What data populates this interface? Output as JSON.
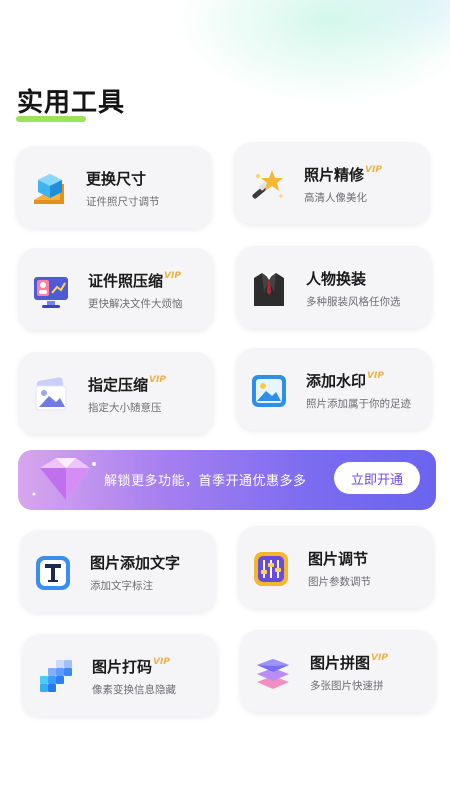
{
  "page": {
    "title": "实用工具"
  },
  "tools": [
    {
      "name": "更换尺寸",
      "desc": "证件照尺寸调节",
      "vip": "",
      "icon": "resize-cube-ruler-icon"
    },
    {
      "name": "照片精修",
      "desc": "高清人像美化",
      "vip": "VIP",
      "icon": "magic-wand-star-icon"
    },
    {
      "name": "证件照压缩",
      "desc": "更快解决文件大烦恼",
      "vip": "VIP",
      "icon": "monitor-id-photo-icon"
    },
    {
      "name": "人物换装",
      "desc": "多种服装风格任你选",
      "vip": "",
      "icon": "suit-jacket-icon"
    },
    {
      "name": "指定压缩",
      "desc": "指定大小随意压",
      "vip": "VIP",
      "icon": "stacked-photos-icon"
    },
    {
      "name": "添加水印",
      "desc": "照片添加属于你的足迹",
      "vip": "VIP",
      "icon": "landscape-image-icon"
    },
    {
      "name": "图片添加文字",
      "desc": "添加文字标注",
      "vip": "",
      "icon": "text-t-icon"
    },
    {
      "name": "图片调节",
      "desc": "图片参数调节",
      "vip": "",
      "icon": "sliders-adjust-icon"
    },
    {
      "name": "图片打码",
      "desc": "像素变换信息隐藏",
      "vip": "VIP",
      "icon": "pixel-mosaic-icon"
    },
    {
      "name": "图片拼图",
      "desc": "多张图片快速拼",
      "vip": "VIP",
      "icon": "layered-collage-icon"
    }
  ],
  "banner": {
    "text": "解锁更多功能，首季开通优惠多多",
    "button": "立即开通",
    "icon": "diamond-gem-icon"
  },
  "colors": {
    "accent": "#9be35a",
    "vip": "#e9b347",
    "banner_start": "#d8a6ee",
    "banner_end": "#6a64ef"
  }
}
